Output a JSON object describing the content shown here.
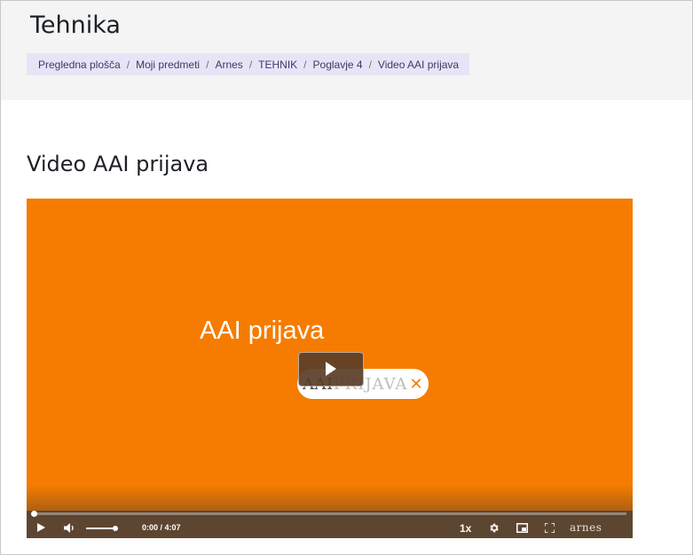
{
  "header": {
    "site_title": "Tehnika",
    "breadcrumb": [
      {
        "label": "Pregledna plošča"
      },
      {
        "label": "Moji predmeti"
      },
      {
        "label": "Arnes"
      },
      {
        "label": "TEHNIK"
      },
      {
        "label": "Poglavje 4"
      },
      {
        "label": "Video AAI prijava"
      }
    ],
    "separator": "/"
  },
  "activity": {
    "title": "Video AAI prijava"
  },
  "video": {
    "caption": "AAI prijava",
    "logo": {
      "part1": "AAI",
      "part2": "PRIJAVA"
    },
    "progress_fraction": 0.0,
    "volume_fraction": 1.0,
    "time": "0:00 / 4:07",
    "speed": "1x",
    "brand": "arnes",
    "background_color": "#f57c00",
    "icons": [
      "play-icon",
      "volume-icon",
      "gear-icon",
      "picture-in-picture-icon",
      "fullscreen-icon"
    ]
  }
}
